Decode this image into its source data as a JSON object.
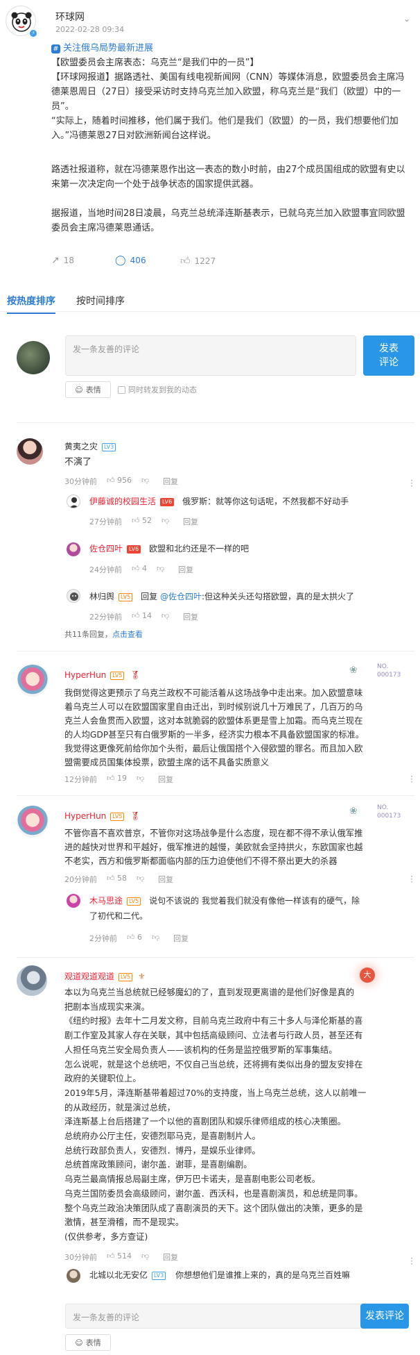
{
  "post": {
    "author": "环球网",
    "time": "2022-02-28 09:34",
    "topic": "关注俄乌局势最新进展",
    "topic_icon": "#",
    "paragraphs": [
      "【欧盟委员会主席表态：乌克兰“是我们中的一员”】",
      "【环球网报道】据路透社、美国有线电视新闻网（CNN）等媒体消息，欧盟委员会主席冯德莱恩周日（27日）接受采访时支持乌克兰加入欧盟，称乌克兰是“我们（欧盟）中的一员”。",
      "“实际上，随着时间推移，他们属于我们。他们是我们（欧盟）的一员，我们想要他们加入。”冯德莱恩27日对欧洲新闻台这样说。",
      "路透社报道称，就在冯德莱恩作出这一表态的数小时前，由27个成员国组成的欧盟有史以来第一次决定向一个处于战争状态的国家提供武器。",
      "据报道，当地时间28日凌晨，乌克兰总统泽连斯基表示，已就乌克兰加入欧盟事宜同欧盟委员会主席冯德莱恩通话。"
    ],
    "reposts": "18",
    "comments": "406",
    "likes": "1227"
  },
  "tabs": [
    "按热度排序",
    "按时间排序"
  ],
  "compose": {
    "placeholder": "发一条友善的评论",
    "submit": "发表评论",
    "emoji": "表情",
    "repost_label": "同时转发到我的动态"
  },
  "comments": [
    {
      "user": "黄夷之灾",
      "level": "LV3",
      "text": "不演了",
      "time": "30分钟前",
      "likes": "956",
      "reply": "回复",
      "replies": [
        {
          "user": "伊藤诚的校园生活",
          "level": "LV6",
          "text": "俄罗斯：就等你这句话呢，不然我都不好动手",
          "time": "27分钟前",
          "likes": "52",
          "reply": "回复"
        },
        {
          "user": "佐仓四叶",
          "level": "LV6",
          "text": "欧盟和北约还是不一样的吧",
          "time": "24分钟前",
          "likes": "4",
          "reply": "回复"
        },
        {
          "user": "林归舆",
          "level": "LV5",
          "prefix": "回复",
          "mention": "@佐仓四叶",
          "text": ":但这种关头还勾搭欧盟，真的是太拱火了",
          "time": "22分钟前",
          "likes": "14",
          "reply": "回复"
        }
      ],
      "more": "共11条回复，",
      "more_link": "点击查看"
    },
    {
      "user": "HyperHun",
      "level": "LV5",
      "badge_no": "NO.",
      "badge_num": "000173",
      "lines": [
        "我倒觉得这更预示了乌克兰政权不可能活着从这场战争中走出来。加入欧盟意味",
        "着乌克兰人可以在欧盟国家里自由迁出，到时候别说几十万难民了，几百万的乌",
        "克兰人会鱼贯而入欧盟，这对本就脆弱的欧盟体系更是雪上加霜。而乌克兰现在",
        "的人均GDP甚至只有白俄罗斯的一半多，经济实力根本不具备欧盟国家的标准。",
        "我觉得这更像死前给你加个头衔，最后让俄国搭个入侵欧盟的罪名。而且加入欧",
        "盟需要成员国集体投票，欧盟主席的话不具备实质意义"
      ],
      "time": "12分钟前",
      "likes": "19",
      "reply": "回复"
    },
    {
      "user": "HyperHun",
      "level": "LV5",
      "badge_no": "NO.",
      "badge_num": "000173",
      "lines": [
        "不管你喜不喜欢普京，不管你对这场战争是什么态度，现在都不得不承认俄军推",
        "进的越快对世界和平越好，俄军推进的越慢，美欧就会坚持拱火，东欧国家也越",
        "不老实，西方和俄罗斯都面临内部的压力迫使他们不得不祭出更大的杀器"
      ],
      "time": "20分钟前",
      "likes": "58",
      "reply": "回复",
      "replies": [
        {
          "user": "木马思途",
          "level": "LV5",
          "lines": [
            "说句不该说的 我觉着我们就没有像他一样该有的硬气，除",
            "了初代和二代。"
          ],
          "time": "2分钟前",
          "likes": "6",
          "reply": "回复"
        }
      ]
    },
    {
      "user": "观道观道观道",
      "level": "LV5",
      "lines": [
        "本以为乌克兰当总统就已经够魔幻的了，直到发现更离谱的是他们好像是真的",
        "把剧本当成现实来演。",
        "《纽约时报》去年十二月发文称，目前乌克兰政府中有三十多人与泽伦斯基的喜",
        "剧工作室及其家人存在关联，其中包括高级顾问、立法者与行政人员，甚至还有",
        "人担任乌克兰安全局负责人——该机构的任务是监控俄罗斯的军事集结。",
        "怎么说呢，就是这个总统吧，不仅自己当总统，还将拥有类似出身的盟友安排在",
        "政府的关键职位上。",
        "2019年5月，泽连斯基带着超过70%的支持度，当上乌克兰总统，这人以前唯一",
        "的从政经历，就是演过总统，",
        "泽连斯基上台后搭建了一个以他的喜剧团队和娱乐律师组成的核心决策圈。",
        "总统府办公厅主任，安德烈耶马克，是喜剧制片人。",
        "总统行政部负责人，安德烈．博丹，是娱乐业律师。",
        "总统首席政策顾问，谢尔盖．谢菲，是喜剧编剧。",
        "乌克兰最高情报总局副主席，伊万巴卡诺夫，是喜剧电影公司老板。",
        "乌克兰国防委员会高级顾问，谢尔盖．西沃科，也是喜剧演员，和总统是同事。",
        "整个乌克兰政治决策团队成了喜剧演员的天下。这个团队做出的决策，更多的是",
        "激情，甚至滑稽，而不是现实。",
        "(仅供参考，多方查证)"
      ],
      "time": "30分钟前",
      "likes": "514",
      "reply": "回复",
      "replies": [
        {
          "user": "北城以北无安亿",
          "level": "LV3",
          "text": "你想想他们是谁推上来的，真的是乌克兰百姓嘛"
        }
      ]
    }
  ],
  "bottom_compose": {
    "placeholder": "发一条友善的评论",
    "submit": "发表评论",
    "emoji": "表情"
  }
}
